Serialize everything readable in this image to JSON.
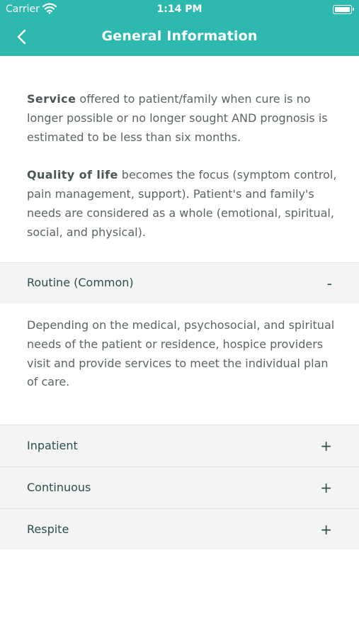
{
  "status_bar": {
    "carrier": "Carrier",
    "time": "1:14 PM"
  },
  "header": {
    "title": "General Information"
  },
  "intro": {
    "paragraph1": {
      "lead": "Service",
      "rest": " offered to patient/family when cure is no longer possible or no longer sought AND prognosis is estimated to be less than six months."
    },
    "paragraph2": {
      "lead": "Quality of life",
      "rest": " becomes the focus (symptom control, pain management, support). Patient's and family's needs are considered as a whole (emotional, spiritual, social, and physical)."
    }
  },
  "sections": [
    {
      "label": "Routine (Common)",
      "sign": "-",
      "expanded": true,
      "body": "Depending on the medical, psychosocial, and spiritual needs of the patient or residence, hospice providers visit and provide services to meet the individual plan of care."
    },
    {
      "label": "Inpatient",
      "sign": "+",
      "expanded": false
    },
    {
      "label": "Continuous",
      "sign": "+",
      "expanded": false
    },
    {
      "label": "Respite",
      "sign": "+",
      "expanded": false
    }
  ],
  "colors": {
    "accent": "#2db8b0",
    "section_bg": "#f4f4f4",
    "section_text": "#2a4f4c"
  }
}
